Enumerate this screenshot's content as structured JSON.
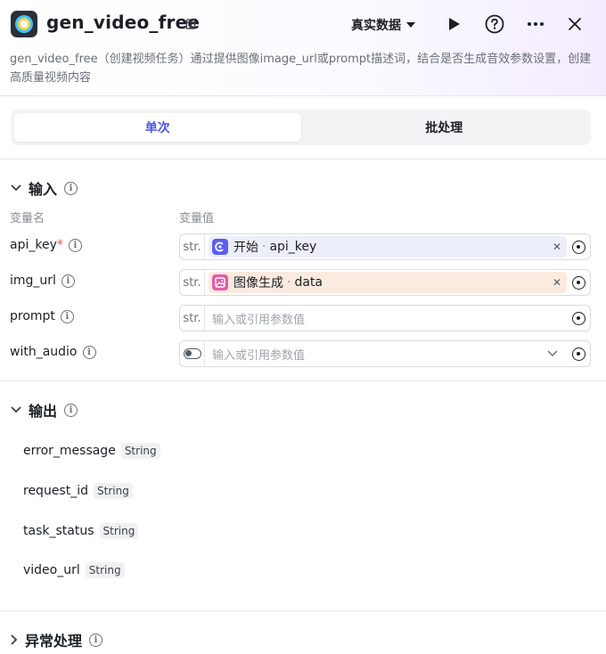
{
  "header": {
    "title": "gen_video_free",
    "mode_label": "真实数据",
    "description": "gen_video_free（创建视频任务）通过提供图像image_url或prompt描述词，结合是否生成音效参数设置，创建高质量视频内容"
  },
  "tabs": [
    {
      "label": "单次",
      "active": true
    },
    {
      "label": "批处理",
      "active": false
    }
  ],
  "input_section": {
    "title": "输入",
    "col_name": "变量名",
    "col_value": "变量值",
    "rows": [
      {
        "name": "api_key",
        "required": true,
        "type": "str.",
        "ref_node": "开始",
        "ref_var": "api_key",
        "ref_color": "blue"
      },
      {
        "name": "img_url",
        "required": false,
        "type": "str.",
        "ref_node": "图像生成",
        "ref_var": "data",
        "ref_color": "orange"
      },
      {
        "name": "prompt",
        "required": false,
        "type": "str.",
        "placeholder": "输入或引用参数值"
      },
      {
        "name": "with_audio",
        "required": false,
        "type": "toggle",
        "placeholder": "输入或引用参数值"
      }
    ]
  },
  "output_section": {
    "title": "输出",
    "rows": [
      {
        "name": "error_message",
        "type": "String"
      },
      {
        "name": "request_id",
        "type": "String"
      },
      {
        "name": "task_status",
        "type": "String"
      },
      {
        "name": "video_url",
        "type": "String"
      }
    ]
  },
  "error_section": {
    "title": "异常处理"
  }
}
